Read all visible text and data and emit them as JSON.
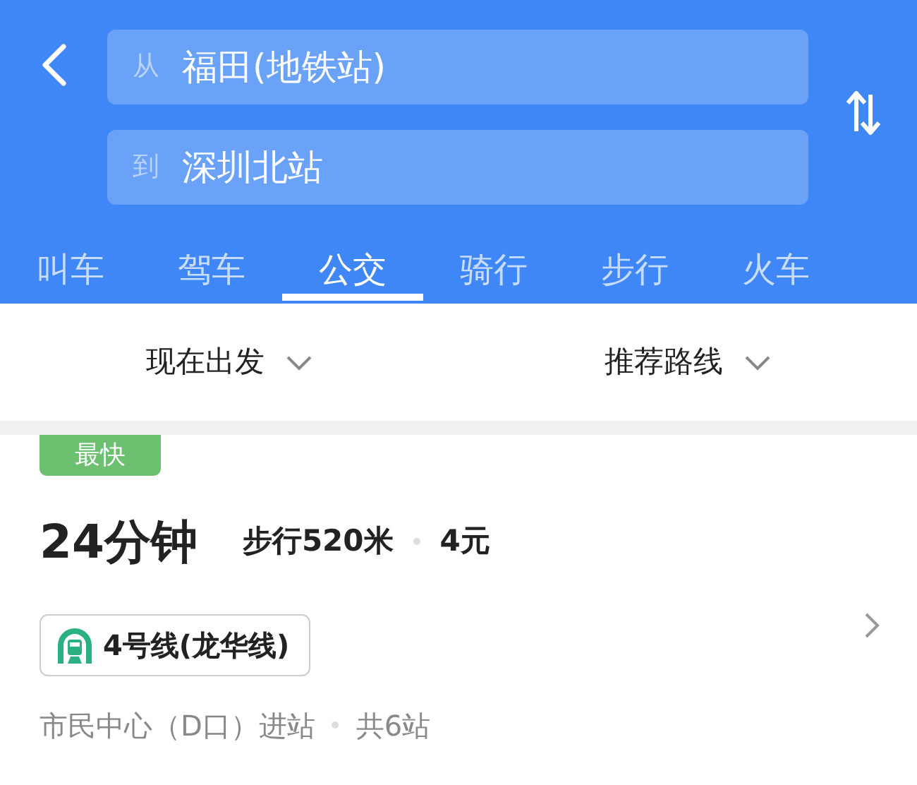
{
  "search": {
    "from": {
      "label": "从",
      "value": "福田(地铁站)"
    },
    "to": {
      "label": "到",
      "value": "深圳北站"
    }
  },
  "tabs": [
    {
      "label": "叫车",
      "selected": false
    },
    {
      "label": "驾车",
      "selected": false
    },
    {
      "label": "公交",
      "selected": true
    },
    {
      "label": "骑行",
      "selected": false
    },
    {
      "label": "步行",
      "selected": false
    },
    {
      "label": "火车",
      "selected": false
    }
  ],
  "filters": [
    {
      "label": "现在出发"
    },
    {
      "label": "推荐路线"
    }
  ],
  "route": {
    "badge": "最快",
    "duration": "24分钟",
    "walk": "步行520米",
    "fare": "4元",
    "line": "4号线(龙华线)",
    "entry": "市民中心（D口）进站",
    "stops": "共6站"
  }
}
